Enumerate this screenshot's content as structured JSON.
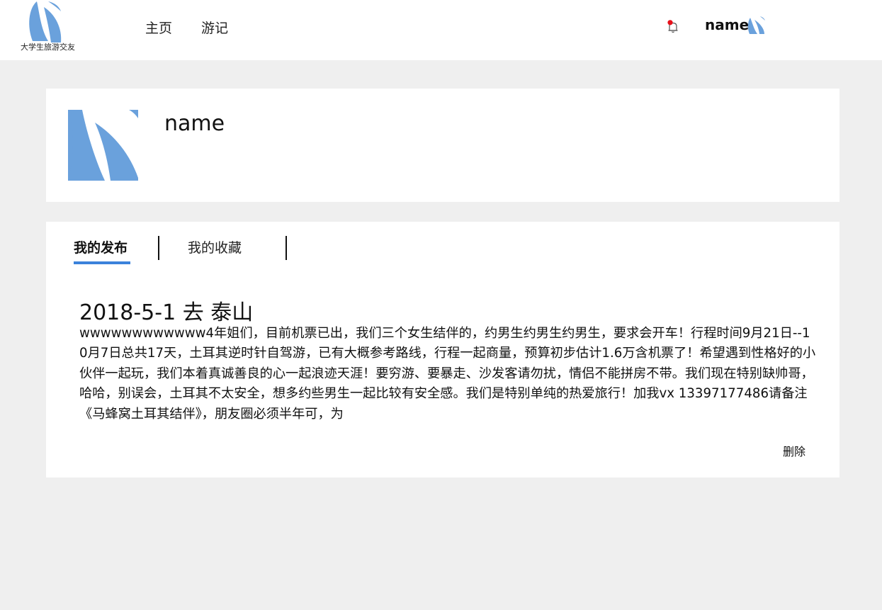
{
  "header": {
    "logo_text": "大学生旅游交友",
    "nav": [
      "主页",
      "游记"
    ],
    "user_name": "name",
    "bell_icon": "bell-icon",
    "notification_dot_color": "#e8101a"
  },
  "profile": {
    "name": "name"
  },
  "tabs": [
    "我的发布",
    "我的收藏"
  ],
  "active_tab": "我的发布",
  "accent_color": "#3b82db",
  "post": {
    "title": "2018-5-1 去 泰山",
    "body": "wwwwwwwwwwww4年姐们，目前机票已出，我们三个女生结伴的，约男生约男生约男生，要求会开车！行程时间9月21日--10月7日总共17天，土耳其逆时针自驾游，已有大概参考路线，行程一起商量，预算初步估计1.6万含机票了！希望遇到性格好的小伙伴一起玩，我们本着真诚善良的心一起浪迹天涯！要穷游、要暴走、沙发客请勿扰，情侣不能拼房不带。我们现在特别缺帅哥，哈哈，别误会，土耳其不太安全，想多约些男生一起比较有安全感。我们是特别单纯的热爱旅行！加我vx 13397177486请备注《马蜂窝土耳其结伴》，朋友圈必须半年可，为",
    "delete_label": "删除"
  }
}
